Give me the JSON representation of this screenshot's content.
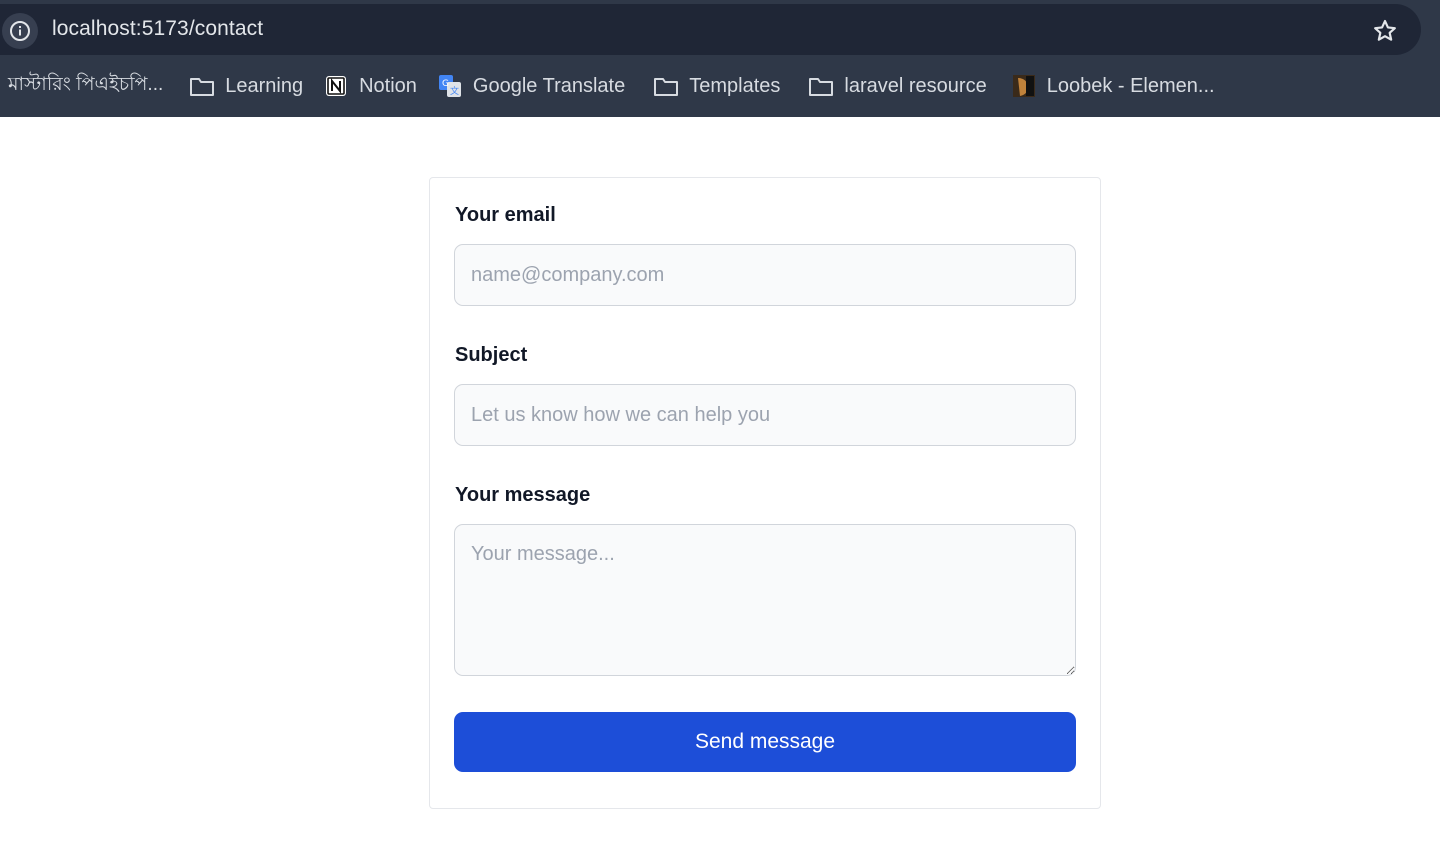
{
  "browser": {
    "url": "localhost:5173/contact",
    "bookmarks": [
      {
        "label": "মাস্টারিং পিএইচপি...",
        "icon": "none"
      },
      {
        "label": "Learning",
        "icon": "folder-icon"
      },
      {
        "label": "Notion",
        "icon": "notion-icon"
      },
      {
        "label": "Google Translate",
        "icon": "google-translate-icon"
      },
      {
        "label": "Templates",
        "icon": "folder-icon"
      },
      {
        "label": "laravel resource",
        "icon": "folder-icon"
      },
      {
        "label": "Loobek - Elemen...",
        "icon": "site-favicon-icon"
      }
    ]
  },
  "form": {
    "email_label": "Your email",
    "email_placeholder": "name@company.com",
    "subject_label": "Subject",
    "subject_placeholder": "Let us know how we can help you",
    "message_label": "Your message",
    "message_placeholder": "Your message...",
    "submit_label": "Send message"
  },
  "colors": {
    "chrome_bg": "#2f3848",
    "omnibox_bg": "#1f2636",
    "button_bg": "#1d4ed8",
    "input_bg": "#f9fafb"
  }
}
